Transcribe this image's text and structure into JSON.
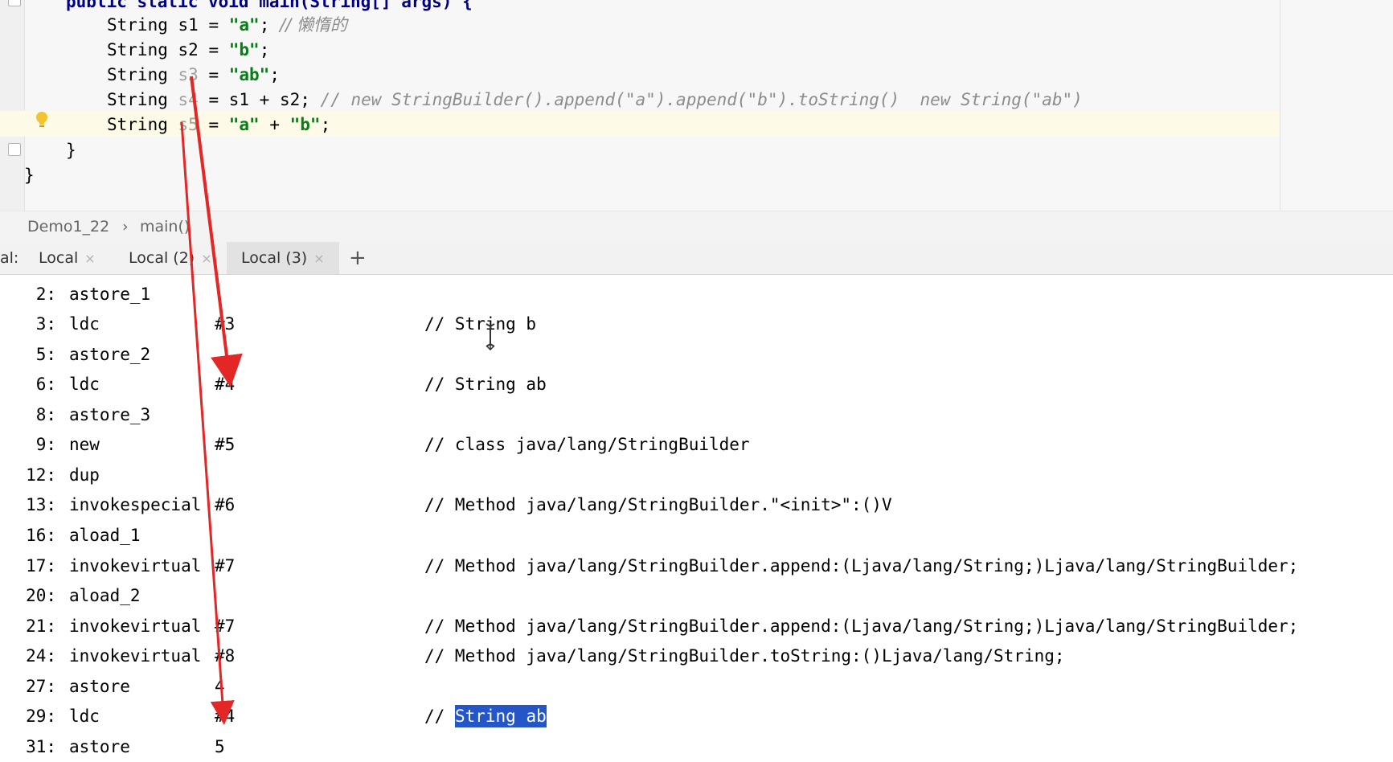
{
  "editor": {
    "header_partial": "public static void main(String[] args) {",
    "lines": [
      {
        "type": "String",
        "var": "s1",
        "op": " = ",
        "value": "\"a\"",
        "end": ";",
        "comment": "// 懒惰的"
      },
      {
        "type": "String",
        "var": "s2",
        "op": " = ",
        "value": "\"b\"",
        "end": ";",
        "comment": ""
      },
      {
        "type": "String",
        "var": "s3",
        "op": " = ",
        "value": "\"ab\"",
        "end": ";",
        "comment": ""
      },
      {
        "type": "String",
        "var": "s4",
        "op": " = s1 + s2;",
        "value": "",
        "end": "",
        "comment": "// new StringBuilder().append(\"a\").append(\"b\").toString()  new String(\"ab\")"
      },
      {
        "type": "String",
        "var": "s5",
        "op": " = ",
        "value": "\"a\"",
        "plus": " + ",
        "value2": "\"b\"",
        "end": ";",
        "comment": ""
      }
    ],
    "closing_inner": "}",
    "closing_outer": "}"
  },
  "breadcrumb": {
    "items": [
      "Demo1_22",
      "main()"
    ],
    "separator": "›"
  },
  "terminal_tabs": {
    "prefix": "al:",
    "tabs": [
      {
        "label": "Local",
        "close": "×"
      },
      {
        "label": "Local (2)",
        "close": "×"
      },
      {
        "label": "Local (3)",
        "close": "×",
        "active": true
      }
    ],
    "add": "+"
  },
  "bytecode": [
    {
      "idx": "2:",
      "op": "astore_1",
      "arg": "",
      "comment": ""
    },
    {
      "idx": "3:",
      "op": "ldc",
      "arg": "#3",
      "comment": "// String b"
    },
    {
      "idx": "5:",
      "op": "astore_2",
      "arg": "",
      "comment": ""
    },
    {
      "idx": "6:",
      "op": "ldc",
      "arg": "#4",
      "comment": "// String ab"
    },
    {
      "idx": "8:",
      "op": "astore_3",
      "arg": "",
      "comment": ""
    },
    {
      "idx": "9:",
      "op": "new",
      "arg": "#5",
      "comment": "// class java/lang/StringBuilder"
    },
    {
      "idx": "12:",
      "op": "dup",
      "arg": "",
      "comment": ""
    },
    {
      "idx": "13:",
      "op": "invokespecial",
      "arg": "#6",
      "comment": "// Method java/lang/StringBuilder.\"<init>\":()V"
    },
    {
      "idx": "16:",
      "op": "aload_1",
      "arg": "",
      "comment": ""
    },
    {
      "idx": "17:",
      "op": "invokevirtual",
      "arg": "#7",
      "comment": "// Method java/lang/StringBuilder.append:(Ljava/lang/String;)Ljava/lang/StringBuilder;"
    },
    {
      "idx": "20:",
      "op": "aload_2",
      "arg": "",
      "comment": ""
    },
    {
      "idx": "21:",
      "op": "invokevirtual",
      "arg": "#7",
      "comment": "// Method java/lang/StringBuilder.append:(Ljava/lang/String;)Ljava/lang/StringBuilder;"
    },
    {
      "idx": "24:",
      "op": "invokevirtual",
      "arg": "#8",
      "comment": "// Method java/lang/StringBuilder.toString:()Ljava/lang/String;"
    },
    {
      "idx": "27:",
      "op": "astore",
      "arg": "4",
      "comment": ""
    },
    {
      "idx": "29:",
      "op": "ldc",
      "arg": "#4",
      "comment_prefix": "// ",
      "comment_selected": "String ab"
    },
    {
      "idx": "31:",
      "op": "astore",
      "arg": "5",
      "comment": ""
    }
  ],
  "colors": {
    "keyword": "#000080",
    "string": "#067d17",
    "comment": "#8c8c8c",
    "selection": "#2456c7",
    "annotation_arrow": "#e32626"
  }
}
